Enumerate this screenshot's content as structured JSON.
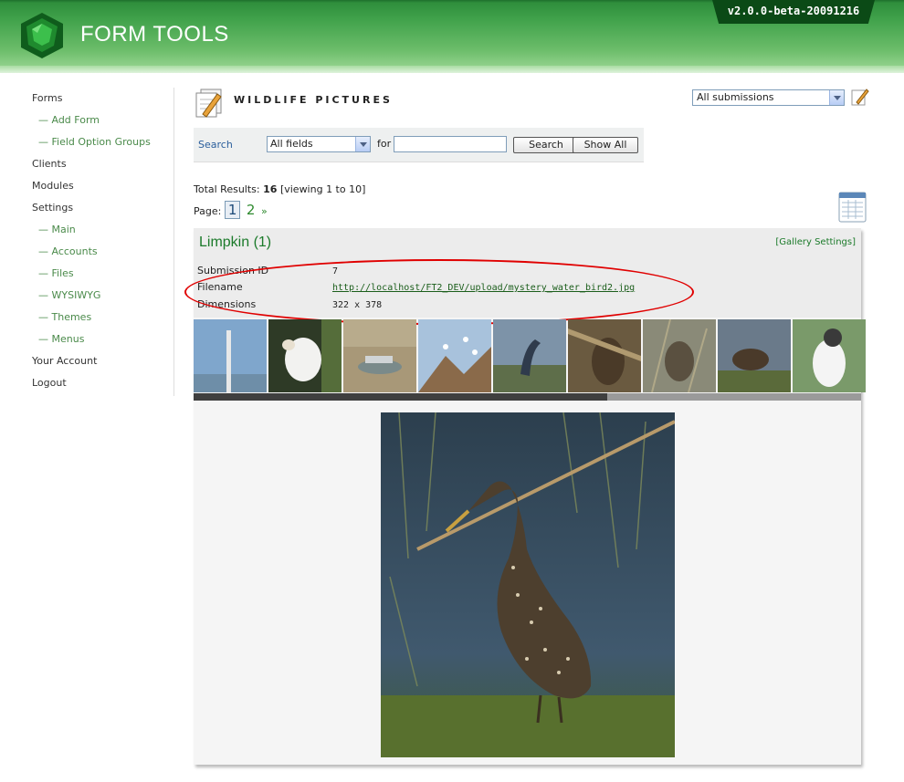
{
  "header": {
    "logo_text": "FORM TOOLS",
    "version": "v2.0.0-beta-20091216"
  },
  "nav": {
    "items": [
      {
        "label": "Forms",
        "sub": false
      },
      {
        "label": "— Add Form",
        "sub": true
      },
      {
        "label": "— Field Option Groups",
        "sub": true
      },
      {
        "label": "Clients",
        "sub": false
      },
      {
        "label": "Modules",
        "sub": false
      },
      {
        "label": "Settings",
        "sub": false
      },
      {
        "label": "— Main",
        "sub": true
      },
      {
        "label": "— Accounts",
        "sub": true
      },
      {
        "label": "— Files",
        "sub": true
      },
      {
        "label": "— WYSIWYG",
        "sub": true
      },
      {
        "label": "— Themes",
        "sub": true
      },
      {
        "label": "— Menus",
        "sub": true
      },
      {
        "label": "Your Account",
        "sub": false
      },
      {
        "label": "Logout",
        "sub": false
      }
    ]
  },
  "page": {
    "title": "WILDLIFE PICTURES",
    "view_select": "All submissions"
  },
  "search": {
    "label": "Search",
    "field_select": "All fields",
    "for_label": "for",
    "query": "",
    "search_button": "Search",
    "show_all_button": "Show All"
  },
  "results": {
    "prefix": "Total Results:",
    "total": "16",
    "viewing": "[viewing 1 to 10]",
    "page_label": "Page:",
    "current_page": "1",
    "other_page": "2",
    "next": "»"
  },
  "gallery": {
    "title": "Limpkin (1)",
    "settings_link": "[Gallery Settings]",
    "fields": {
      "submission_id_label": "Submission ID",
      "submission_id": "7",
      "filename_label": "Filename",
      "filename": "http://localhost/FT2_DEV/upload/mystery_water_bird2.jpg",
      "dimensions_label": "Dimensions",
      "dimensions": "322 x 378"
    },
    "thumbnail_count": 9,
    "scroll_progress": 0.62
  },
  "colors": {
    "brand_green": "#3fa14a",
    "link_green": "#1b7a2a",
    "annotation_red": "#e00000"
  }
}
